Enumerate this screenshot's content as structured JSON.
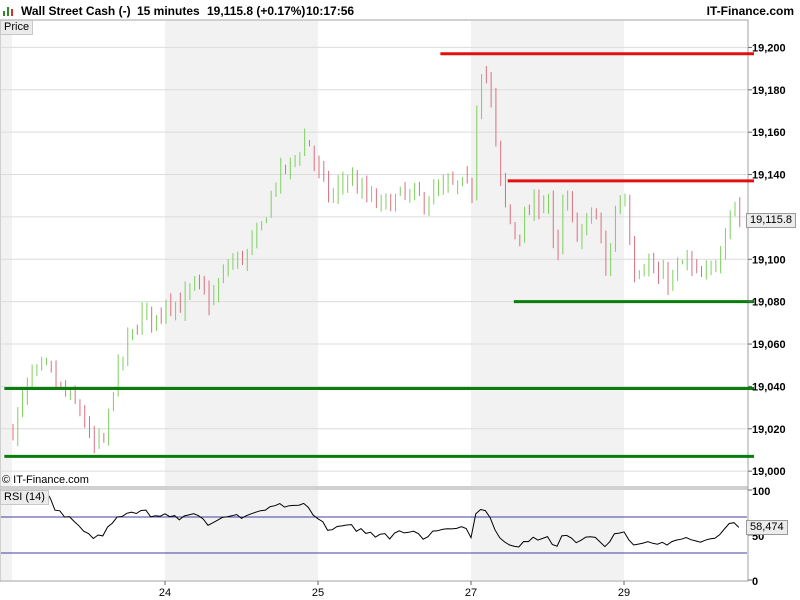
{
  "header": {
    "instrument": "Wall Street Cash (-)",
    "timeframe": "15 minutes",
    "price_change": "19,115.8 (+0.17%)",
    "time": "10:17:56",
    "brand": "IT-Finance.com",
    "logo_icon": "bar-chart-icon"
  },
  "price_panel": {
    "label": "Price",
    "last_price_tag": "19,115.8",
    "copyright": "© IT-Finance.com"
  },
  "rsi_panel": {
    "label": "RSI (14)",
    "value_tag": "58,474",
    "yticks": [
      {
        "v": 100,
        "label": "100"
      },
      {
        "v": 50,
        "label": "50"
      },
      {
        "v": 0,
        "label": "0"
      }
    ],
    "levels": [
      70,
      30
    ]
  },
  "colors": {
    "up": "#7ed05f",
    "down": "#d97080",
    "resistance": "#e41010",
    "support": "#0a7d0a",
    "rsi_line": "#000000",
    "rsi_level": "#4040a0",
    "band": "#f2f2f2",
    "grid": "#dcdcdc"
  },
  "chart_data": {
    "type": "candlestick",
    "xticks": [
      {
        "label": "24",
        "day": 1
      },
      {
        "label": "25",
        "day": 2
      },
      {
        "label": "27",
        "day": 3
      },
      {
        "label": "29",
        "day": 4
      }
    ],
    "yticks": [
      19000,
      19020,
      19040,
      19060,
      19080,
      19100,
      19120,
      19140,
      19160,
      19180,
      19200
    ],
    "ytick_labels": [
      "19,000",
      "19,020",
      "19,040",
      "19,060",
      "19,080",
      "19,100",
      "19,120",
      "19,140",
      "19,160",
      "19,180",
      "19,200"
    ],
    "ylim": [
      18993,
      19212
    ],
    "last_price": 19115.8,
    "path": [
      [
        0.0,
        19020
      ],
      [
        0.12,
        19045
      ],
      [
        0.22,
        19048
      ],
      [
        0.35,
        19035
      ],
      [
        0.45,
        19028
      ],
      [
        0.52,
        19010
      ],
      [
        0.6,
        19015
      ],
      [
        0.66,
        19042
      ],
      [
        0.75,
        19060
      ],
      [
        0.85,
        19075
      ],
      [
        0.95,
        19072
      ],
      [
        1.0,
        19082
      ],
      [
        1.1,
        19078
      ],
      [
        1.18,
        19088
      ],
      [
        1.3,
        19080
      ],
      [
        1.4,
        19097
      ],
      [
        1.52,
        19102
      ],
      [
        1.6,
        19110
      ],
      [
        1.72,
        19138
      ],
      [
        1.82,
        19145
      ],
      [
        1.92,
        19158
      ],
      [
        2.0,
        19140
      ],
      [
        2.08,
        19128
      ],
      [
        2.18,
        19140
      ],
      [
        2.3,
        19130
      ],
      [
        2.4,
        19125
      ],
      [
        2.55,
        19130
      ],
      [
        2.7,
        19128
      ],
      [
        2.78,
        19132
      ],
      [
        2.92,
        19135
      ],
      [
        3.0,
        19132
      ],
      [
        3.04,
        19185
      ],
      [
        3.07,
        19193
      ],
      [
        3.12,
        19178
      ],
      [
        3.18,
        19138
      ],
      [
        3.24,
        19118
      ],
      [
        3.3,
        19112
      ],
      [
        3.4,
        19125
      ],
      [
        3.5,
        19130
      ],
      [
        3.55,
        19092
      ],
      [
        3.6,
        19130
      ],
      [
        3.7,
        19110
      ],
      [
        3.8,
        19125
      ],
      [
        3.88,
        19092
      ],
      [
        3.94,
        19125
      ],
      [
        4.0,
        19130
      ],
      [
        4.06,
        19095
      ],
      [
        4.14,
        19100
      ],
      [
        4.22,
        19090
      ],
      [
        4.32,
        19092
      ],
      [
        4.4,
        19100
      ],
      [
        4.48,
        19090
      ],
      [
        4.55,
        19092
      ],
      [
        4.62,
        19105
      ],
      [
        4.7,
        19128
      ],
      [
        4.78,
        19116
      ]
    ],
    "candles_per_day": 32,
    "support_lines": [
      {
        "price": 19039,
        "from_day": -0.05,
        "to_day": 4.85
      },
      {
        "price": 19007,
        "from_day": -0.05,
        "to_day": 4.85
      },
      {
        "price": 19080,
        "from_day": 3.28,
        "to_day": 4.85
      }
    ],
    "resistance_lines": [
      {
        "price": 19197,
        "from_day": 2.8,
        "to_day": 4.85
      },
      {
        "price": 19137,
        "from_day": 3.24,
        "to_day": 4.85
      }
    ],
    "rsi": {
      "ylim": [
        0,
        100
      ],
      "last": 58.474
    }
  }
}
